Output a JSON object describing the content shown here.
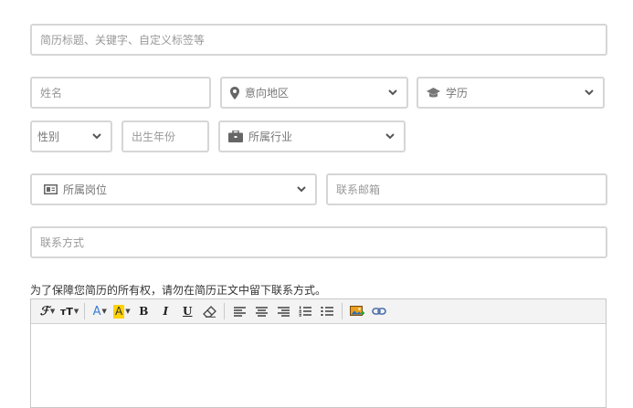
{
  "resume_title": {
    "placeholder": "简历标题、关键字、自定义标签等"
  },
  "name": {
    "placeholder": "姓名"
  },
  "desired_region": {
    "label": "意向地区",
    "icon": "location-pin-icon"
  },
  "education": {
    "label": "学历",
    "icon": "graduation-cap-icon"
  },
  "gender": {
    "label": "性别"
  },
  "birth_year": {
    "placeholder": "出生年份"
  },
  "industry": {
    "label": "所属行业",
    "icon": "briefcase-icon"
  },
  "position": {
    "label": "所属岗位",
    "icon": "id-card-icon"
  },
  "email": {
    "placeholder": "联系邮箱"
  },
  "contact": {
    "placeholder": "联系方式"
  },
  "notice": "为了保障您简历的所有权，请勿在简历正文中留下联系方式。",
  "editor": {
    "toolbar": {
      "font_family_glyph": "ℱ",
      "font_size_glyph": "тT",
      "font_color_glyph": "A",
      "highlight_glyph": "A",
      "bold_glyph": "B",
      "italic_glyph": "I",
      "underline_glyph": "U"
    },
    "colors": {
      "font_color": "#3b7fd4",
      "highlight": "#ffd200"
    }
  }
}
